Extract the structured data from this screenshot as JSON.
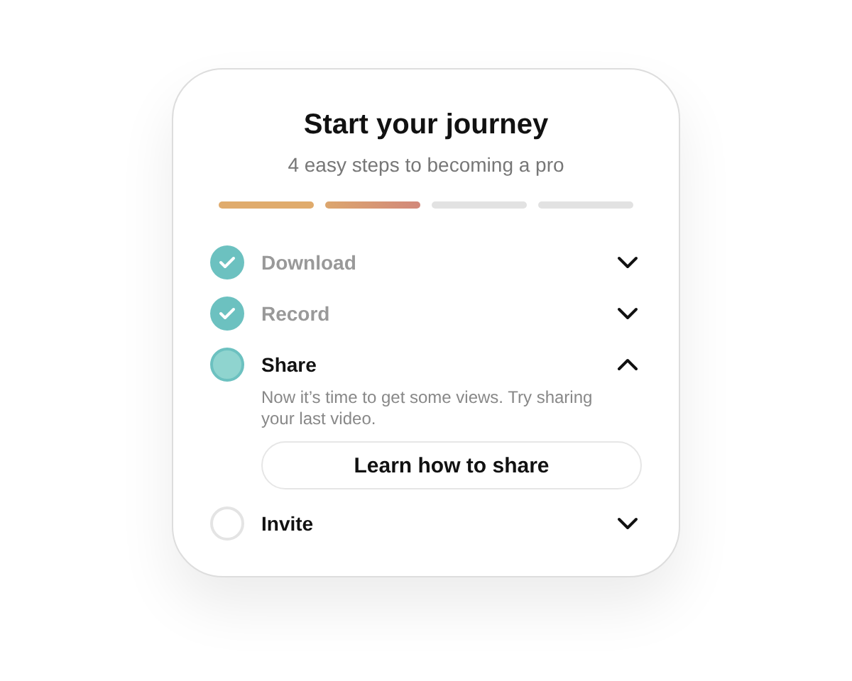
{
  "title": "Start your journey",
  "subtitle": "4 easy steps to becoming a pro",
  "progress": [
    {
      "kind": "complete"
    },
    {
      "kind": "current"
    },
    {
      "kind": "pending"
    },
    {
      "kind": "pending"
    }
  ],
  "steps": [
    {
      "label": "Download",
      "kind": "done",
      "expanded": false
    },
    {
      "label": "Record",
      "kind": "done",
      "expanded": false
    },
    {
      "label": "Share",
      "kind": "current",
      "expanded": true,
      "description": "Now it’s time to get some views. Try sharing your last video.",
      "button": "Learn how to share"
    },
    {
      "label": "Invite",
      "kind": "todo",
      "expanded": false
    }
  ]
}
